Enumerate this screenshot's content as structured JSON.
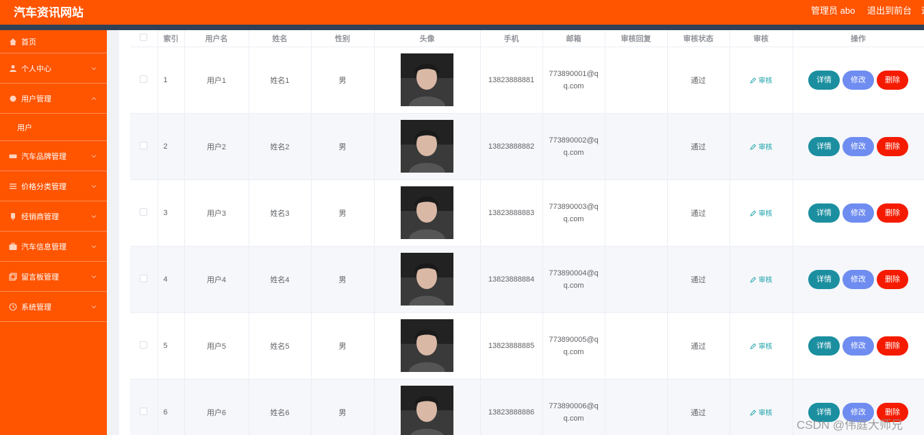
{
  "header": {
    "site_title": "汽车资讯网站",
    "admin_label": "管理员 abo",
    "logout_label": "退出到前台",
    "overflow_text": "退"
  },
  "colors": {
    "brand": "#ff5400",
    "detail_button": "#1b8fa0",
    "edit_button": "#6f8df0",
    "delete_button": "#f51b00",
    "audit_link": "#15a0a8"
  },
  "sidebar": {
    "items": [
      {
        "label": "首页",
        "icon": "home-icon"
      },
      {
        "label": "个人中心",
        "icon": "person-icon"
      },
      {
        "label": "用户管理",
        "icon": "user-manage-icon"
      },
      {
        "label": "用户",
        "icon": ""
      },
      {
        "label": "汽车品牌管理",
        "icon": "car-icon"
      },
      {
        "label": "价格分类管理",
        "icon": "list-icon"
      },
      {
        "label": "经销商管理",
        "icon": "dealer-icon"
      },
      {
        "label": "汽车信息管理",
        "icon": "briefcase-icon"
      },
      {
        "label": "留言板管理",
        "icon": "message-icon"
      },
      {
        "label": "系统管理",
        "icon": "settings-icon"
      }
    ]
  },
  "table": {
    "columns": [
      "索引",
      "用户名",
      "姓名",
      "性别",
      "头像",
      "手机",
      "邮箱",
      "审核回复",
      "审核状态",
      "审核",
      "操作"
    ],
    "audit_link_label": "审核",
    "actions": {
      "detail": "详情",
      "edit": "修改",
      "delete": "删除"
    },
    "rows": [
      {
        "index": "1",
        "username": "用户1",
        "name": "姓名1",
        "gender": "男",
        "phone": "13823888881",
        "email": "773890001@qq.com",
        "reply": "",
        "status": "通过"
      },
      {
        "index": "2",
        "username": "用户2",
        "name": "姓名2",
        "gender": "男",
        "phone": "13823888882",
        "email": "773890002@qq.com",
        "reply": "",
        "status": "通过"
      },
      {
        "index": "3",
        "username": "用户3",
        "name": "姓名3",
        "gender": "男",
        "phone": "13823888883",
        "email": "773890003@qq.com",
        "reply": "",
        "status": "通过"
      },
      {
        "index": "4",
        "username": "用户4",
        "name": "姓名4",
        "gender": "男",
        "phone": "13823888884",
        "email": "773890004@qq.com",
        "reply": "",
        "status": "通过"
      },
      {
        "index": "5",
        "username": "用户5",
        "name": "姓名5",
        "gender": "男",
        "phone": "13823888885",
        "email": "773890005@qq.com",
        "reply": "",
        "status": "通过"
      },
      {
        "index": "6",
        "username": "用户6",
        "name": "姓名6",
        "gender": "男",
        "phone": "13823888886",
        "email": "773890006@qq.com",
        "reply": "",
        "status": "通过"
      }
    ]
  },
  "watermark": "CSDN @伟庭大师兄"
}
